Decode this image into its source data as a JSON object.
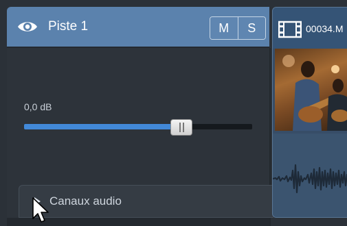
{
  "track": {
    "name": "Piste 1",
    "mute_label": "M",
    "solo_label": "S",
    "volume_text": "0,0 dB",
    "volume_level": 0.69,
    "channels_label": "Canaux audio"
  },
  "clip": {
    "name": "00034.M"
  },
  "colors": {
    "track_header": "#5b82ad",
    "slider_fill": "#4289d8",
    "background": "#2b3138",
    "clip_body": "#374d67"
  },
  "icons": {
    "visibility": "eye-icon",
    "clip_type": "film-icon",
    "expand": "triangle-right-icon",
    "pointer": "mouse-cursor-icon"
  }
}
